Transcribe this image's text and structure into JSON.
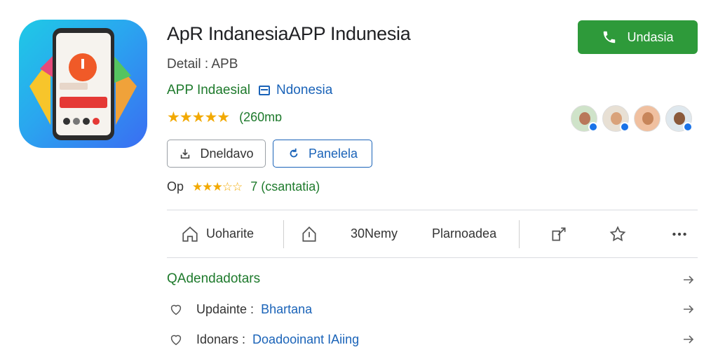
{
  "app": {
    "title": "ApR IndanesiaAPP Indunesia",
    "subtitle": "Detail : APB",
    "developer": "APP Indaesial",
    "developer_link": "Ndonesia",
    "rating_count": "(260mɒ",
    "stars": "★★★★★",
    "rating_value": 4.5
  },
  "install_button": {
    "label": "Undasia",
    "color": "#2e9a3a"
  },
  "buttons": {
    "secondary_1": "Dneldavo",
    "secondary_2": "Panelela"
  },
  "sub_rating": {
    "label": "Op",
    "stars": "★★★☆☆",
    "meta": "7 (csantatia)",
    "value": 3.5
  },
  "actions": {
    "favorite": "Uoharite",
    "count": "30Nemy",
    "planned": "Plarnoadea"
  },
  "info_list": {
    "heading": "QAdendadotars",
    "rows": [
      {
        "key": "Updainte :",
        "value": "Bhartana"
      },
      {
        "key": "Idonars :",
        "value": "Doadooinant IAiing"
      }
    ]
  },
  "colors": {
    "accent_green": "#2e9a3a",
    "link_blue": "#1a63b8",
    "star": "#f2a900"
  },
  "icons": [
    "phone-icon",
    "download-icon",
    "refresh-icon",
    "home-icon",
    "share-icon",
    "star-icon",
    "more-icon",
    "heart-icon",
    "arrow-right-icon",
    "verified-icon"
  ]
}
